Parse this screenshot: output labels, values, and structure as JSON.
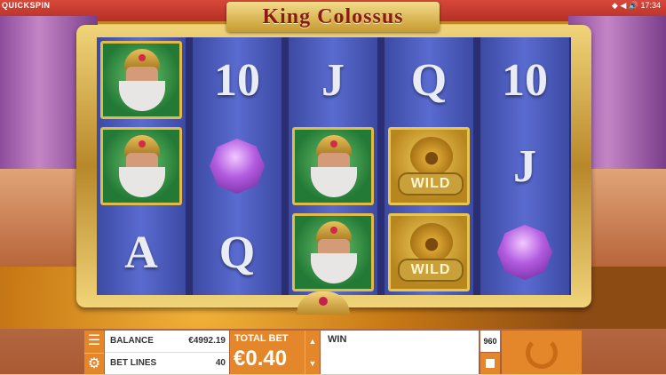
{
  "brand": "QUICKSPIN",
  "status": {
    "icons": "◆ ◀ 🔊",
    "time": "17:34"
  },
  "title": "King Colossus",
  "reels": [
    [
      {
        "type": "king",
        "name": "king-symbol"
      },
      {
        "type": "king",
        "name": "king-symbol"
      },
      {
        "type": "letter",
        "value": "A"
      }
    ],
    [
      {
        "type": "letter",
        "value": "10"
      },
      {
        "type": "gem",
        "name": "purple-gem-symbol"
      },
      {
        "type": "letter",
        "value": "Q"
      }
    ],
    [
      {
        "type": "letter",
        "value": "J"
      },
      {
        "type": "king",
        "name": "king-symbol"
      },
      {
        "type": "king",
        "name": "king-symbol"
      }
    ],
    [
      {
        "type": "letter",
        "value": "Q"
      },
      {
        "type": "wild",
        "value": "WILD"
      },
      {
        "type": "wild",
        "value": "WILD"
      }
    ],
    [
      {
        "type": "letter",
        "value": "10"
      },
      {
        "type": "letter",
        "value": "J"
      },
      {
        "type": "gem",
        "name": "purple-gem-symbol"
      }
    ]
  ],
  "panel": {
    "balance_label": "BALANCE",
    "balance_value": "€4992.19",
    "bet_lines_label": "BET LINES",
    "bet_lines_value": "40"
  },
  "total_bet": {
    "label": "TOTAL BET",
    "value": "€0.40"
  },
  "win": {
    "label": "WIN"
  },
  "autoplay_count": "960",
  "colors": {
    "accent": "#e4872a",
    "reel": "#4a5ac0",
    "frame_gold": "#d9b552",
    "title_red": "#8a1b12"
  },
  "icons": {
    "menu": "menu-icon",
    "settings": "gear-icon",
    "spin": "spin-arrow-icon",
    "stop": "stop-icon",
    "up": "chevron-up-icon",
    "down": "chevron-down-icon"
  }
}
